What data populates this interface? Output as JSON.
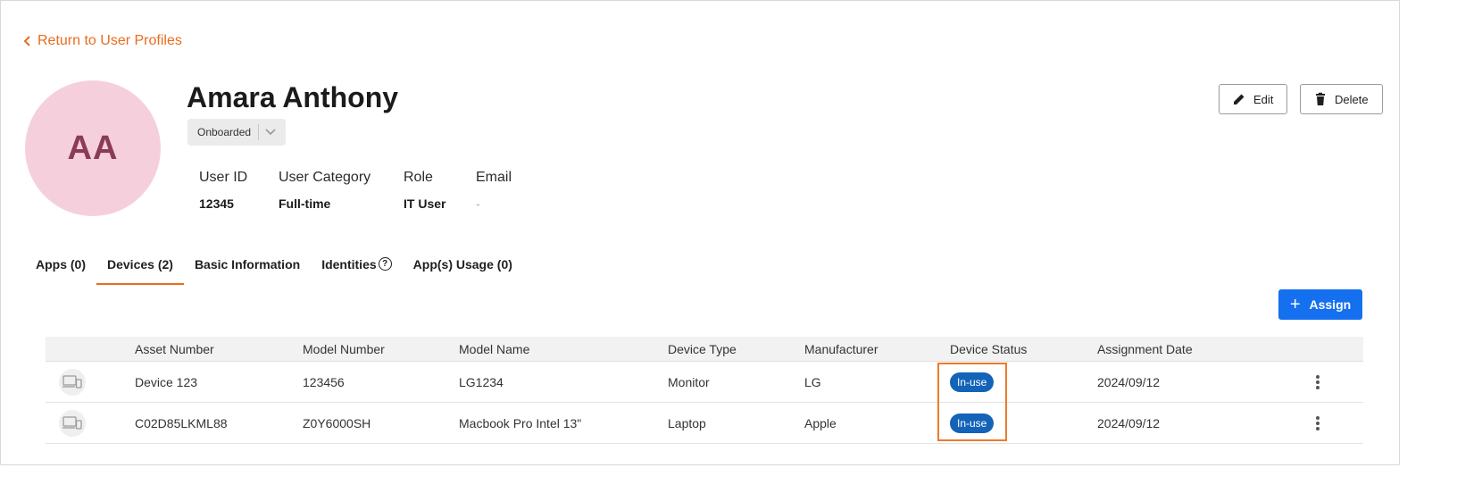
{
  "nav": {
    "back_label": "Return to User Profiles"
  },
  "profile": {
    "initials": "AA",
    "name": "Amara Anthony",
    "status": "Onboarded",
    "fields": [
      {
        "label": "User ID",
        "value": "12345"
      },
      {
        "label": "User Category",
        "value": "Full-time"
      },
      {
        "label": "Role",
        "value": "IT User"
      },
      {
        "label": "Email",
        "value": "-"
      }
    ]
  },
  "actions": {
    "edit_label": "Edit",
    "delete_label": "Delete",
    "assign_label": "Assign"
  },
  "tabs": [
    {
      "label": "Apps (0)"
    },
    {
      "label": "Devices (2)",
      "active": true
    },
    {
      "label": "Basic Information"
    },
    {
      "label": "Identities"
    },
    {
      "label": "App(s) Usage (0)"
    }
  ],
  "table": {
    "columns": [
      "Asset Number",
      "Model Number",
      "Model Name",
      "Device Type",
      "Manufacturer",
      "Device Status",
      "Assignment Date"
    ],
    "rows": [
      {
        "asset_number": "Device 123",
        "model_number": "123456",
        "model_name": "LG1234",
        "device_type": "Monitor",
        "manufacturer": "LG",
        "device_status": "In-use",
        "assignment_date": "2024/09/12"
      },
      {
        "asset_number": "C02D85LKML88",
        "model_number": "Z0Y6000SH",
        "model_name": "Macbook Pro Intel 13\"",
        "device_type": "Laptop",
        "manufacturer": "Apple",
        "device_status": "In-use",
        "assignment_date": "2024/09/12"
      }
    ]
  },
  "colors": {
    "accent": "#ea6b1e",
    "primary": "#1570ef",
    "badge": "#1363b8",
    "avatar_bg": "#f5d0dc",
    "avatar_text": "#8a3b55"
  },
  "icons": [
    "chevron-left-icon",
    "chevron-down-icon",
    "pencil-icon",
    "trash-icon",
    "help-circle-icon",
    "plus-icon",
    "device-icon",
    "kebab-menu-icon"
  ]
}
